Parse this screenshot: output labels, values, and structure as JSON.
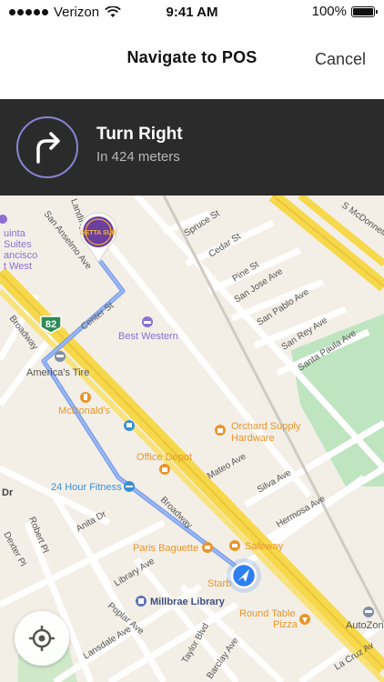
{
  "status_bar": {
    "carrier": "Verizon",
    "time": "9:41 AM",
    "battery": "100%"
  },
  "header": {
    "title": "Navigate to POS",
    "cancel_label": "Cancel"
  },
  "turn": {
    "instruction": "Turn Right",
    "distance": "In 424 meters"
  },
  "map": {
    "destination_badge": "GETTA SUB",
    "route_sign": "82",
    "streets": {
      "spruce": "Spruce St",
      "cedar": "Cedar St",
      "pine": "Pine St",
      "san_jose": "San Jose Ave",
      "san_pablo": "San Pablo Ave",
      "san_rey": "San Rey Ave",
      "santa_paula": "Santa Paula Ave",
      "s_mcdonnell": "S McDonnell",
      "landing": "Landing",
      "san_anselmo": "San Anselmo Ave",
      "center": "Center St",
      "broadway_left": "Broadway",
      "broadway_mid": "Broadway",
      "mateo": "Mateo Ave",
      "silva": "Silva Ave",
      "hermosa": "Hermosa Ave",
      "anita": "Anita Dr",
      "robert": "Robert Pl",
      "dexter": "Dexter Pl",
      "library": "Library Ave",
      "poplar": "Poplar Ave",
      "lansdale": "Lansdale Ave",
      "taylor": "Taylor Blvd",
      "barclay": "Barclay Ave",
      "la_cruz": "La Cruz Av",
      "dr_fragment": "Dr"
    },
    "pois": {
      "quinta_1": "uinta",
      "quinta_2": "Suites",
      "quinta_3": "ancisco",
      "quinta_4": "t West",
      "best_western": "Best Western",
      "americas_tire": "America's Tire",
      "mcdonalds": "McDonald's",
      "orchard_1": "Orchard Supply",
      "orchard_2": "Hardware",
      "office_depot": "Office Depot",
      "fitness": "24 Hour Fitness",
      "paris_baguette": "Paris Baguette",
      "safeway": "Safeway",
      "starbucks": "Starb",
      "millbrae_library": "Millbrae Library",
      "round_table_1": "Round Table",
      "round_table_2": "Pizza",
      "autozone": "AutoZon"
    }
  },
  "colors": {
    "route": "#7ea1ea",
    "highway": "#f6d84a",
    "park": "#bfe5c0",
    "banner": "#2b2b2b",
    "accent": "#8a84d6",
    "poi_orange": "#e8952a",
    "poi_blue": "#3a8fd6",
    "poi_purple": "#8b6fd3"
  },
  "icons": {
    "turn": "turn-right-arrow-icon",
    "locate": "crosshair-locate-icon",
    "user": "navigation-arrow-icon"
  }
}
